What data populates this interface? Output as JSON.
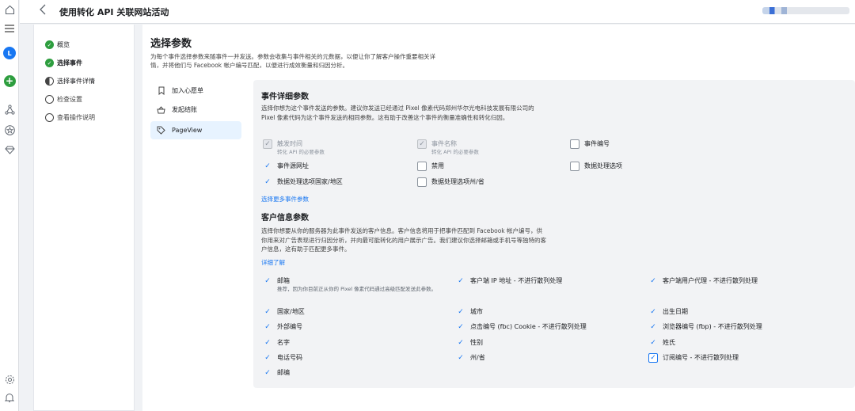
{
  "rail": {
    "icons": [
      "home-icon",
      "menu-icon",
      "avatar",
      "create-icon",
      "graph-icon",
      "star-icon",
      "diamond-icon",
      "settings-icon",
      "bell-icon"
    ],
    "avatar_letter": "L"
  },
  "header": {
    "back_icon": "back-arrow-icon",
    "title": "使用转化 API 关联网站活动"
  },
  "steps": [
    {
      "label": "概览",
      "state": "done"
    },
    {
      "label": "选择事件",
      "state": "done"
    },
    {
      "label": "选择事件详情",
      "state": "half"
    },
    {
      "label": "检查设置",
      "state": "empty"
    },
    {
      "label": "查看操作说明",
      "state": "empty"
    }
  ],
  "main": {
    "title": "选择参数",
    "desc": "为每个事件选择参数来随事件一并发送。参数会收集与事件相关的元数据，以便让你了解客户操作重要相关详情，并将他们与 Facebook 帐户编号匹配，以便进行成效衡量和归因分析。"
  },
  "events": [
    {
      "label": "加入心愿单",
      "icon": "bookmark-icon"
    },
    {
      "label": "发起结账",
      "icon": "basket-icon"
    },
    {
      "label": "PageView",
      "icon": "tag-icon",
      "selected": true
    }
  ],
  "event_details": {
    "title": "事件详细参数",
    "desc": "选择你想为这个事件发送的参数。建议你发送已经通过 Pixel 像素代码郑州华尔光电科技发展有限公司的 Pixel 像素代码为这个事件发送的相同参数。这有助于改善这个事件的衡量准确性和转化归因。",
    "params": [
      {
        "label": "触发时间",
        "sub": "转化 API 的必要参数",
        "checked": true,
        "disabled": true
      },
      {
        "label": "事件名称",
        "sub": "转化 API 的必要参数",
        "checked": true,
        "disabled": true
      },
      {
        "label": "事件编号",
        "checked": false
      },
      {
        "label": "事件源网址",
        "checked": true
      },
      {
        "label": "禁用",
        "checked": false
      },
      {
        "label": "数据处理选项",
        "checked": false
      },
      {
        "label": "数据处理选项国家/地区",
        "checked": true
      },
      {
        "label": "数据处理选项州/省",
        "checked": false
      }
    ],
    "more_link": "选择更多事件参数"
  },
  "customer_info": {
    "title": "客户信息参数",
    "desc": "选择你想要从你的服务器为此事件发送的客户信息。客户信息将用于把事件匹配到 Facebook 帐户编号，供你用来对广告表现进行归因分析，并向最可能转化的用户展示广告。我们建议你选择邮箱或手机号等独特的客户信息，这有助于匹配更多事件。",
    "learn_more": "详细了解",
    "params": [
      {
        "label": "邮箱",
        "sub": "推荐，因为你目前正从你的 Pixel 像素代码通过高级匹配发送此参数。",
        "checked": true
      },
      {
        "label": "客户端 IP 地址 - 不进行散列处理",
        "checked": true
      },
      {
        "label": "客户端用户代理 - 不进行散列处理",
        "checked": true
      },
      {
        "label": "国家/地区",
        "checked": true
      },
      {
        "label": "城市",
        "checked": true
      },
      {
        "label": "出生日期",
        "checked": true
      },
      {
        "label": "外部编号",
        "checked": true
      },
      {
        "label": "点击编号 (fbc) Cookie - 不进行散列处理",
        "checked": true
      },
      {
        "label": "浏览器编号 (fbp) - 不进行散列处理",
        "checked": true
      },
      {
        "label": "名字",
        "checked": true
      },
      {
        "label": "性别",
        "checked": true
      },
      {
        "label": "姓氏",
        "checked": true
      },
      {
        "label": "电话号码",
        "checked": true
      },
      {
        "label": "州/省",
        "checked": true
      },
      {
        "label": "订阅编号 - 不进行散列处理",
        "checked": true,
        "focused": true
      },
      {
        "label": "邮编",
        "checked": true
      }
    ]
  },
  "colors": {
    "accent": "#1877f2",
    "success": "#2e9e3f",
    "panel_bg": "#f2f3f5",
    "page_bg": "#f0f2f5"
  }
}
